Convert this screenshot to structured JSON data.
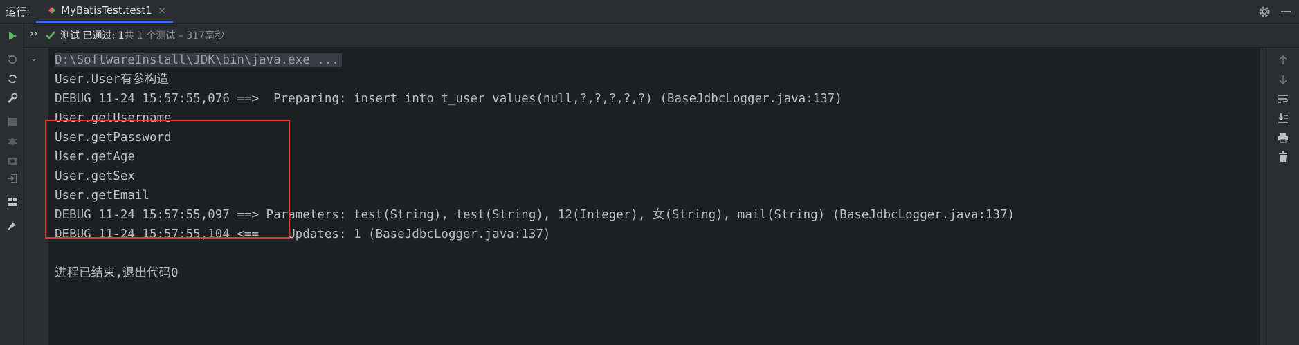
{
  "topbar": {
    "run_label": "运行:",
    "tab_label": "MyBatisTest.test1",
    "tab_close": "×"
  },
  "status": {
    "expand": "››",
    "passed_label": "测试 已通过: 1",
    "summary": "共 1 个测试 – 317毫秒"
  },
  "console": {
    "lines": [
      "D:\\SoftwareInstall\\JDK\\bin\\java.exe ...",
      "User.User有参构造",
      "DEBUG 11-24 15:57:55,076 ==>  Preparing: insert into t_user values(null,?,?,?,?,?) (BaseJdbcLogger.java:137)",
      "User.getUsername",
      "User.getPassword",
      "User.getAge",
      "User.getSex",
      "User.getEmail",
      "DEBUG 11-24 15:57:55,097 ==> Parameters: test(String), test(String), 12(Integer), 女(String), mail(String) (BaseJdbcLogger.java:137)",
      "DEBUG 11-24 15:57:55,104 <==    Updates: 1 (BaseJdbcLogger.java:137)",
      "",
      "进程已结束,退出代码0"
    ]
  },
  "colors": {
    "background": "#2b2d30",
    "console_bg": "#1e1f22",
    "accent": "#3574f0",
    "run_green": "#5fb865",
    "highlight_red": "#e03c31"
  },
  "icons": {
    "left_toolbar": [
      "run-icon",
      "rerun-failed-icon",
      "toggle-auto-test-icon",
      "settings-wrench-icon",
      "stop-icon",
      "debug-icon",
      "screenshot-icon",
      "export-icon",
      "layout-icon",
      "pin-icon"
    ],
    "right_toolbar": [
      "arrow-up-icon",
      "arrow-down-icon",
      "soft-wrap-icon",
      "scroll-to-end-icon",
      "print-icon",
      "trash-icon"
    ]
  }
}
